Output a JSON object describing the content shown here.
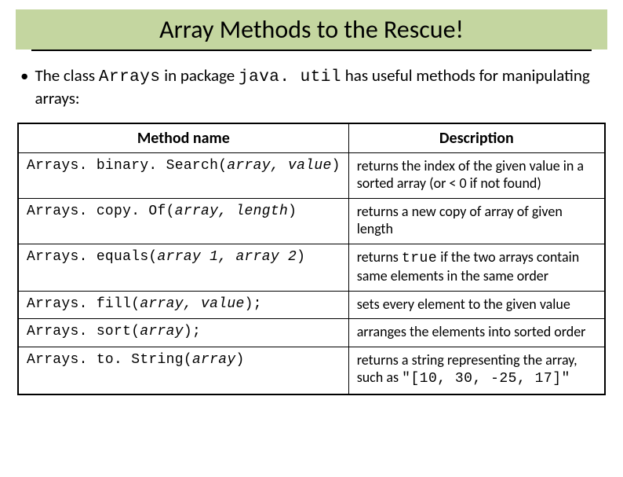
{
  "title": "Array Methods to the Rescue!",
  "bullet_prefix": "The class ",
  "bullet_code1": "Arrays",
  "bullet_mid1": " in package ",
  "bullet_code2": "java. util",
  "bullet_suffix": " has useful methods for manipulating arrays:",
  "headers": {
    "method": "Method name",
    "description": "Description"
  },
  "rows": [
    {
      "method_pre": "Arrays. binary. Search(",
      "method_args": "array, value",
      "method_post": ")",
      "desc_pre": "returns the index of the given value in a sorted array (or < 0 if not found)",
      "desc_code": "",
      "desc_post": ""
    },
    {
      "method_pre": "Arrays. copy. Of(",
      "method_args": "array, length",
      "method_post": ")",
      "desc_pre": "returns a new copy of array of given length",
      "desc_code": "",
      "desc_post": ""
    },
    {
      "method_pre": "Arrays. equals(",
      "method_args": "array 1, array 2",
      "method_post": ")",
      "desc_pre": "returns ",
      "desc_code": "true",
      "desc_post": " if the two arrays contain same elements in the same order"
    },
    {
      "method_pre": "Arrays. fill(",
      "method_args": "array, value",
      "method_post": ");",
      "desc_pre": "sets every element to the given value",
      "desc_code": "",
      "desc_post": ""
    },
    {
      "method_pre": "Arrays. sort(",
      "method_args": "array",
      "method_post": ");",
      "desc_pre": "arranges the elements into sorted order",
      "desc_code": "",
      "desc_post": ""
    },
    {
      "method_pre": "Arrays. to. String(",
      "method_args": "array",
      "method_post": ")",
      "desc_pre": "returns a string representing the array, such as ",
      "desc_code": "\"[10, 30, -25, 17]\"",
      "desc_post": ""
    }
  ]
}
